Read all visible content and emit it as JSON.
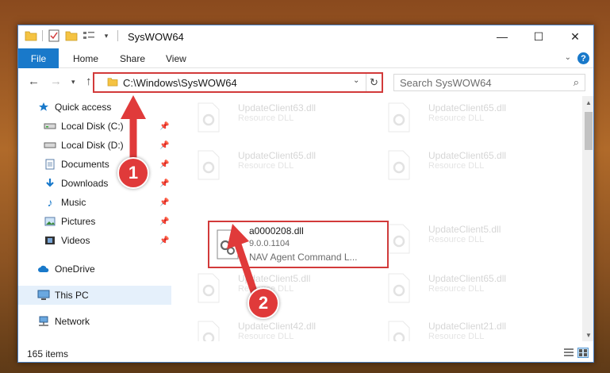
{
  "window": {
    "title": "SysWOW64"
  },
  "window_controls": {
    "minimize": "—",
    "maximize": "☐",
    "close": "✕"
  },
  "ribbon": {
    "tabs": [
      "File",
      "Home",
      "Share",
      "View"
    ],
    "help": "?"
  },
  "address": {
    "path": "C:\\Windows\\SysWOW64"
  },
  "search": {
    "placeholder": "Search SysWOW64"
  },
  "nav_pane": {
    "items": [
      {
        "label": "Quick access",
        "icon": "star-icon"
      },
      {
        "label": "Local Disk (C:)",
        "icon": "drive-icon"
      },
      {
        "label": "Local Disk (D:)",
        "icon": "drive-icon"
      },
      {
        "label": "Documents",
        "icon": "documents-icon"
      },
      {
        "label": "Downloads",
        "icon": "download-icon"
      },
      {
        "label": "Music",
        "icon": "music-icon"
      },
      {
        "label": "Pictures",
        "icon": "pictures-icon"
      },
      {
        "label": "Videos",
        "icon": "videos-icon"
      },
      {
        "label": "OneDrive",
        "icon": "cloud-icon"
      },
      {
        "label": "This PC",
        "icon": "computer-icon"
      },
      {
        "label": "Network",
        "icon": "network-icon"
      }
    ]
  },
  "files": [
    {
      "name": "UpdateClient63.dll",
      "desc": "Resource DLL"
    },
    {
      "name": "UpdateClient65.dll",
      "desc": "Resource DLL"
    },
    {
      "name": "UpdateClient65.dll",
      "desc": "Resource DLL"
    },
    {
      "name": "UpdateClient65.dll",
      "desc": "Resource DLL"
    },
    {
      "name": "a0000208.dll",
      "version": "9.0.0.1104",
      "desc": "NAV Agent Command L..."
    },
    {
      "name": "UpdateClient5.dll",
      "desc": "Resource DLL"
    },
    {
      "name": "UpdateClient5.dll",
      "desc": "Resource DLL"
    },
    {
      "name": "UpdateClient65.dll",
      "desc": "Resource DLL"
    },
    {
      "name": "UpdateClient42.dll",
      "desc": "Resource DLL"
    },
    {
      "name": "UpdateClient21.dll",
      "desc": "Resource DLL"
    }
  ],
  "status": {
    "count": "165 items"
  },
  "annotations": {
    "step1": "1",
    "step2": "2"
  },
  "colors": {
    "accent": "#1979ca",
    "highlight": "#d23a3a",
    "badge": "#e03a3a"
  }
}
